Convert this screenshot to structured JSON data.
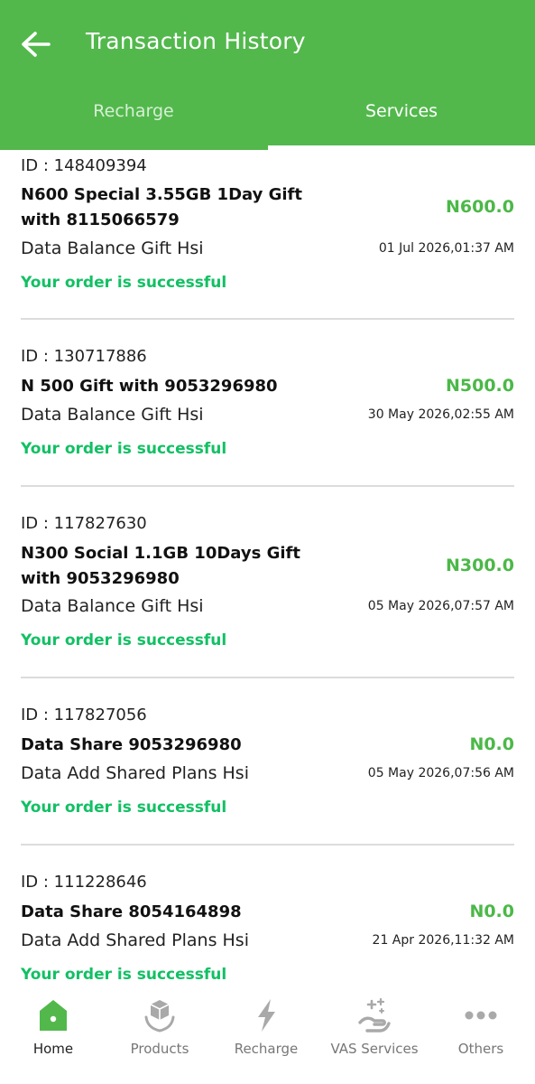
{
  "header": {
    "title": "Transaction History"
  },
  "tabs": [
    {
      "label": "Recharge",
      "active": false
    },
    {
      "label": "Services",
      "active": true
    }
  ],
  "colors": {
    "brand": "#52b84c",
    "amount": "#4cb848",
    "success": "#12c064"
  },
  "transactions": [
    {
      "id": "ID : 148409394",
      "title": "N600 Special  3.55GB 1Day Gift with 8115066579",
      "amount": "N600.0",
      "service": "Data Balance Gift Hsi",
      "datetime": "01 Jul 2026,01:37 AM",
      "status": "Your order is successful"
    },
    {
      "id": "ID : 130717886",
      "title": "N 500 Gift with 9053296980",
      "amount": "N500.0",
      "service": "Data Balance Gift Hsi",
      "datetime": "30 May 2026,02:55 AM",
      "status": "Your order is successful"
    },
    {
      "id": "ID : 117827630",
      "title": "N300 Social  1.1GB 10Days Gift with 9053296980",
      "amount": "N300.0",
      "service": "Data Balance Gift Hsi",
      "datetime": "05 May 2026,07:57 AM",
      "status": "Your order is successful"
    },
    {
      "id": "ID : 117827056",
      "title": "Data Share 9053296980",
      "amount": "N0.0",
      "service": "Data Add Shared Plans Hsi",
      "datetime": "05 May 2026,07:56 AM",
      "status": "Your order is successful"
    },
    {
      "id": "ID : 111228646",
      "title": "Data Share 8054164898",
      "amount": "N0.0",
      "service": "Data Add Shared Plans Hsi",
      "datetime": "21 Apr 2026,11:32 AM",
      "status": "Your order is successful"
    }
  ],
  "bottom_nav": [
    {
      "label": "Home",
      "icon": "home-icon",
      "active": true
    },
    {
      "label": "Products",
      "icon": "box-hand-icon",
      "active": false
    },
    {
      "label": "Recharge",
      "icon": "lightning-icon",
      "active": false
    },
    {
      "label": "VAS Services",
      "icon": "sparkle-hand-icon",
      "active": false
    },
    {
      "label": "Others",
      "icon": "more-dots-icon",
      "active": false
    }
  ]
}
